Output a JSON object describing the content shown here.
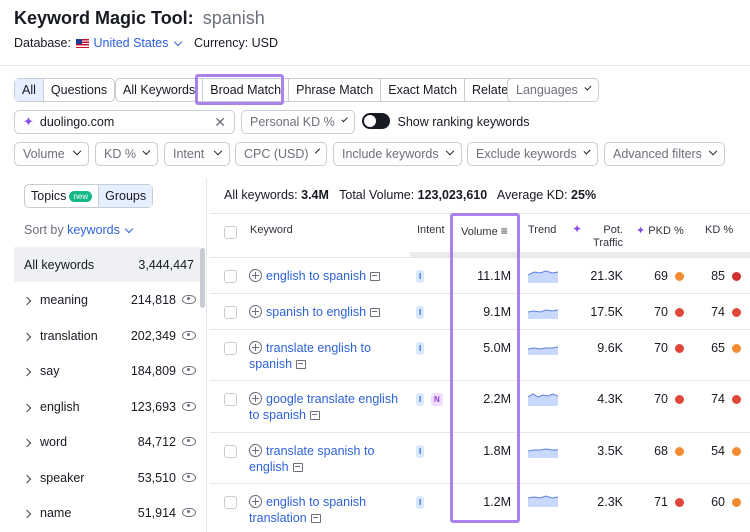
{
  "header": {
    "tool": "Keyword Magic Tool:",
    "query": "spanish",
    "database_label": "Database:",
    "database_value": "United States",
    "currency": "Currency: USD"
  },
  "tabs": [
    "All",
    "Questions"
  ],
  "match_tabs": [
    "All Keywords",
    "Broad Match",
    "Phrase Match",
    "Exact Match",
    "Related"
  ],
  "languages": "Languages",
  "domain_input": {
    "value": "duolingo.com"
  },
  "personal_kd": "Personal KD %",
  "show_ranking": "Show ranking keywords",
  "filters": [
    "Volume",
    "KD %",
    "Intent",
    "CPC (USD)",
    "Include keywords",
    "Exclude keywords",
    "Advanced filters"
  ],
  "sidebar": {
    "tab_topics": "Topics",
    "new_badge": "new",
    "tab_groups": "Groups",
    "sort_by": "Sort by",
    "sort_value": "keywords",
    "items": [
      {
        "name": "All keywords",
        "count": "3,444,447"
      },
      {
        "name": "meaning",
        "count": "214,818"
      },
      {
        "name": "translation",
        "count": "202,349"
      },
      {
        "name": "say",
        "count": "184,809"
      },
      {
        "name": "english",
        "count": "123,693"
      },
      {
        "name": "word",
        "count": "84,712"
      },
      {
        "name": "speaker",
        "count": "53,510"
      },
      {
        "name": "name",
        "count": "51,914"
      }
    ]
  },
  "summary": {
    "all_label": "All keywords:",
    "all_value": "3.4M",
    "tv_label": "Total Volume:",
    "tv_value": "123,023,610",
    "kd_label": "Average KD:",
    "kd_value": "25%"
  },
  "columns": {
    "keyword": "Keyword",
    "intent": "Intent",
    "volume": "Volume",
    "trend": "Trend",
    "pot": "Pot.",
    "traffic": "Traffic",
    "pkd": "PKD %",
    "kd": "KD %"
  },
  "rows": [
    {
      "kw1": "english to spanish",
      "kw2": "",
      "intent": [
        "I"
      ],
      "volume": "11.1M",
      "pot": "21.3K",
      "pkd": "69",
      "pkd_color": "#f28b2f",
      "kd": "85",
      "kd_color": "#d2302f"
    },
    {
      "kw1": "spanish to english",
      "kw2": "",
      "intent": [
        "I"
      ],
      "volume": "9.1M",
      "pot": "17.5K",
      "pkd": "70",
      "pkd_color": "#e0463a",
      "kd": "74",
      "kd_color": "#e0463a"
    },
    {
      "kw1": "translate english to",
      "kw2": "spanish",
      "intent": [
        "I"
      ],
      "volume": "5.0M",
      "pot": "9.6K",
      "pkd": "70",
      "pkd_color": "#e0463a",
      "kd": "65",
      "kd_color": "#f28b2f"
    },
    {
      "kw1": "google translate english",
      "kw2": "to spanish",
      "intent": [
        "I",
        "N"
      ],
      "volume": "2.2M",
      "pot": "4.3K",
      "pkd": "70",
      "pkd_color": "#e0463a",
      "kd": "74",
      "kd_color": "#e0463a"
    },
    {
      "kw1": "translate spanish to",
      "kw2": "english",
      "intent": [
        "I"
      ],
      "volume": "1.8M",
      "pot": "3.5K",
      "pkd": "68",
      "pkd_color": "#f28b2f",
      "kd": "54",
      "kd_color": "#f28b2f"
    },
    {
      "kw1": "english to spanish",
      "kw2": "translation",
      "intent": [
        "I"
      ],
      "volume": "1.2M",
      "pot": "2.3K",
      "pkd": "71",
      "pkd_color": "#e0463a",
      "kd": "60",
      "kd_color": "#f28b2f"
    }
  ]
}
